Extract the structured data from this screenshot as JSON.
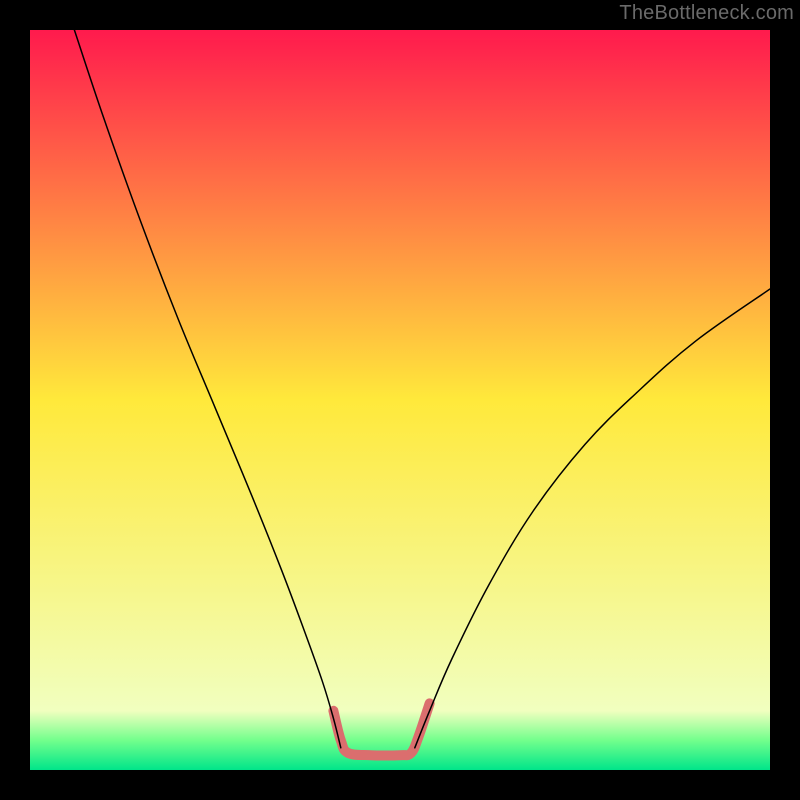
{
  "watermark": "TheBottleneck.com",
  "chart_data": {
    "type": "line",
    "title": "",
    "xlabel": "",
    "ylabel": "",
    "xlim": [
      0,
      100
    ],
    "ylim": [
      0,
      100
    ],
    "background_gradient": {
      "stops": [
        {
          "offset": 0,
          "color": "#ff1a4d"
        },
        {
          "offset": 50,
          "color": "#ffe93b"
        },
        {
          "offset": 92,
          "color": "#f1ffbf"
        },
        {
          "offset": 96,
          "color": "#72ff8c"
        },
        {
          "offset": 100,
          "color": "#00e58a"
        }
      ]
    },
    "series": [
      {
        "name": "left-curve",
        "color": "#000000",
        "width": 1.5,
        "points": [
          {
            "x": 6,
            "y": 100
          },
          {
            "x": 10,
            "y": 88
          },
          {
            "x": 15,
            "y": 74
          },
          {
            "x": 20,
            "y": 61
          },
          {
            "x": 25,
            "y": 49
          },
          {
            "x": 30,
            "y": 37
          },
          {
            "x": 34,
            "y": 27
          },
          {
            "x": 37,
            "y": 19
          },
          {
            "x": 39.5,
            "y": 12
          },
          {
            "x": 41,
            "y": 7
          },
          {
            "x": 42,
            "y": 3
          }
        ]
      },
      {
        "name": "right-curve",
        "color": "#000000",
        "width": 1.5,
        "points": [
          {
            "x": 52,
            "y": 3
          },
          {
            "x": 54,
            "y": 8
          },
          {
            "x": 57,
            "y": 15
          },
          {
            "x": 62,
            "y": 25
          },
          {
            "x": 68,
            "y": 35
          },
          {
            "x": 75,
            "y": 44
          },
          {
            "x": 82,
            "y": 51
          },
          {
            "x": 90,
            "y": 58
          },
          {
            "x": 100,
            "y": 65
          }
        ]
      }
    ],
    "highlight": {
      "name": "bottom-highlight",
      "color": "#db6e6e",
      "width": 10,
      "points": [
        {
          "x": 41,
          "y": 8
        },
        {
          "x": 42,
          "y": 4
        },
        {
          "x": 43,
          "y": 2.3
        },
        {
          "x": 46,
          "y": 2
        },
        {
          "x": 50,
          "y": 2
        },
        {
          "x": 51.5,
          "y": 2.3
        },
        {
          "x": 52.5,
          "y": 4.5
        },
        {
          "x": 54,
          "y": 9
        }
      ]
    }
  }
}
